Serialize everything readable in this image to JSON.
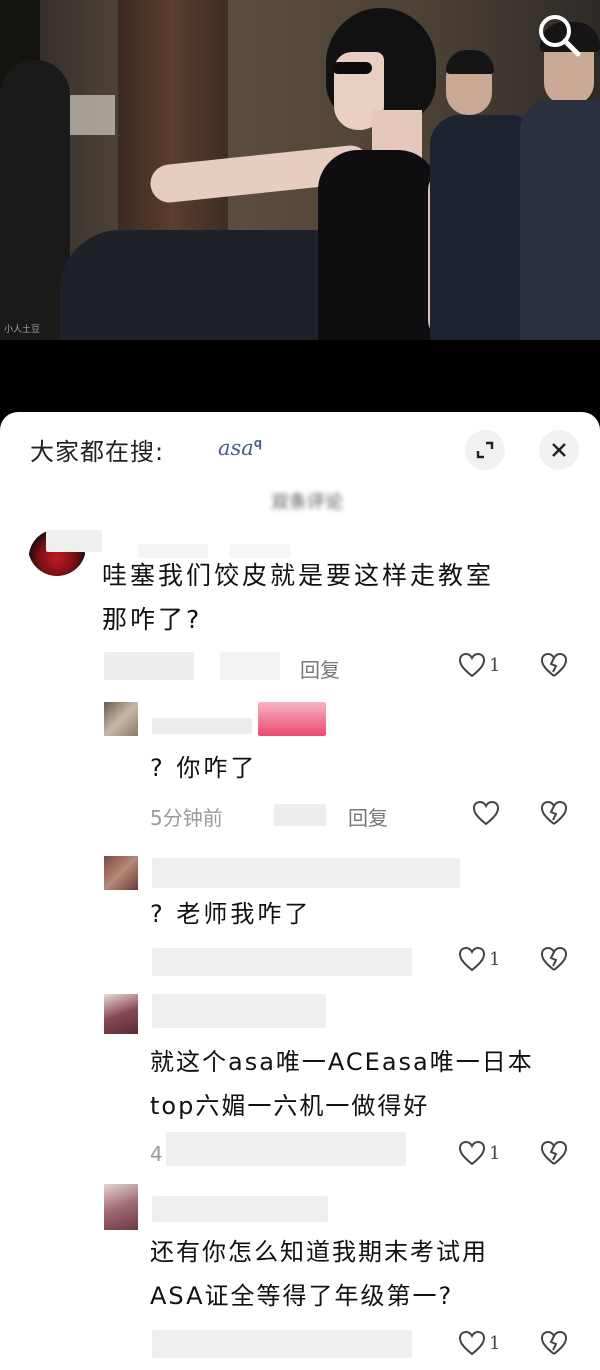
{
  "header": {
    "hot_search_label": "大家都在搜:",
    "hot_search_term": "asa",
    "panel_title": "双条评论"
  },
  "video": {
    "watermark": "小人土豆"
  },
  "comments": [
    {
      "text": "哇塞我们饺皮就是要这样走教室那咋了?",
      "time": "",
      "reply_label": "回复",
      "likes": "1",
      "level": 0
    },
    {
      "text": "? 你咋了",
      "time": "5分钟前",
      "reply_label": "回复",
      "likes": "",
      "level": 1
    },
    {
      "text": "? 老师我咋了",
      "time": "",
      "reply_label": "",
      "likes": "1",
      "level": 1
    },
    {
      "text": "就这个asa唯一ACEasa唯一日本top六媚一六机一做得好",
      "time": "4",
      "reply_label": "",
      "likes": "1",
      "level": 1
    },
    {
      "text": "还有你怎么知道我期末考试用ASA证全等得了年级第一?",
      "time": "",
      "reply_label": "",
      "likes": "1",
      "level": 1
    }
  ],
  "comment_lines": {
    "c0": [
      "哇塞我们饺皮就是要这样走教室",
      "那咋了?"
    ],
    "c3": [
      "就这个asa唯一ACEasa唯一日本",
      "top六媚一六机一做得好"
    ],
    "c4": [
      "还有你怎么知道我期末考试用",
      "ASA证全等得了年级第一?"
    ]
  },
  "icons": {
    "search": "search-icon",
    "expand": "expand-icon",
    "close": "close-icon",
    "like": "heart-icon",
    "dislike": "broken-heart-icon"
  }
}
